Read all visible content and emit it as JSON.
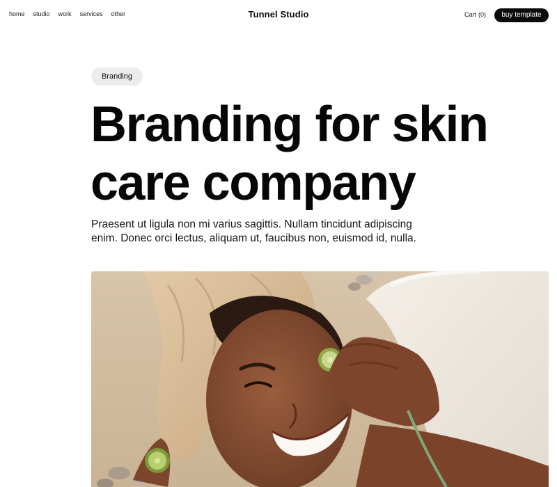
{
  "nav": {
    "items": [
      "home",
      "studio",
      "work",
      "services",
      "other"
    ]
  },
  "brand": {
    "name": "Tunnel Studio"
  },
  "cart": {
    "label": "Cart",
    "count": "(0)"
  },
  "cta": {
    "buy_label": "buy template"
  },
  "hero": {
    "tag": "Branding",
    "title_line1": "Branding for skin",
    "title_line2": "care company",
    "description": "Praesent ut ligula non mi varius sagittis. Nullam tincidunt adipiscing enim. Donec orci lectus, aliquam ut, faucibus non, euismod id, nulla."
  },
  "image": {
    "subject": "woman-with-towel-and-cucumber-slices"
  },
  "colors": {
    "accent": "#0b0b0b",
    "tag_bg": "#ececec",
    "page_bg": "#ffffff"
  }
}
